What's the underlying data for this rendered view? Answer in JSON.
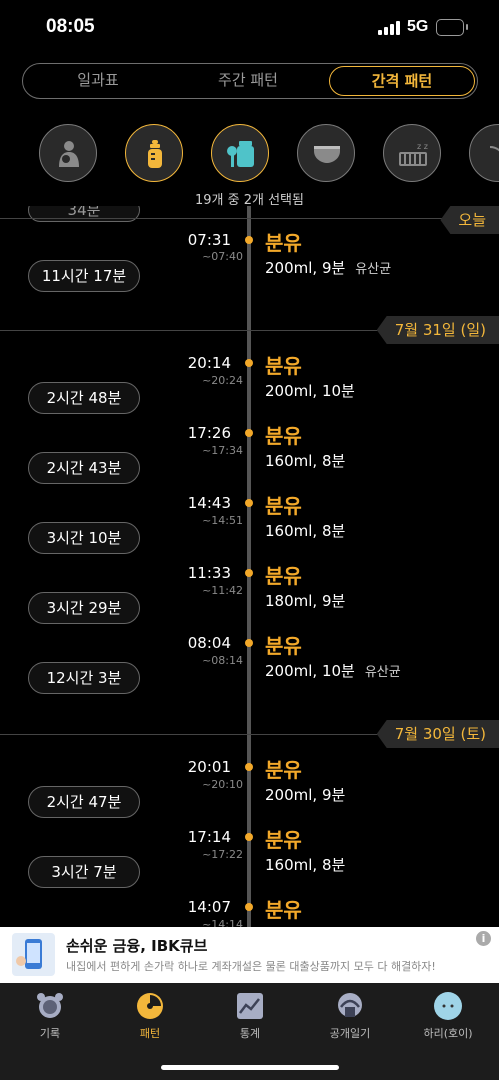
{
  "status": {
    "time": "08:05",
    "network": "5G"
  },
  "tabs": [
    {
      "label": "일과표",
      "active": false
    },
    {
      "label": "주간 패턴",
      "active": false
    },
    {
      "label": "간격 패턴",
      "active": true
    }
  ],
  "categories": [
    {
      "icon": "breastfeeding-icon",
      "selected": false
    },
    {
      "icon": "bottle-icon",
      "selected": true
    },
    {
      "icon": "pumped-milk-icon",
      "selected": true
    },
    {
      "icon": "diaper-icon",
      "selected": false
    },
    {
      "icon": "sleep-icon",
      "selected": false
    },
    {
      "icon": "more-icon",
      "selected": false
    }
  ],
  "selected_count": "19개 중 2개 선택됨",
  "timeline": {
    "partial_top_interval": "34분",
    "dates": {
      "today": "오늘",
      "d1": "7월 31일 (일)",
      "d2": "7월 30일 (토)"
    },
    "entries": [
      {
        "time": "07:31",
        "end": "~07:40",
        "type": "분유",
        "detail": "200ml, 9분",
        "note": "유산균"
      },
      {
        "time": "20:14",
        "end": "~20:24",
        "type": "분유",
        "detail": "200ml, 10분",
        "note": ""
      },
      {
        "time": "17:26",
        "end": "~17:34",
        "type": "분유",
        "detail": "160ml, 8분",
        "note": ""
      },
      {
        "time": "14:43",
        "end": "~14:51",
        "type": "분유",
        "detail": "160ml, 8분",
        "note": ""
      },
      {
        "time": "11:33",
        "end": "~11:42",
        "type": "분유",
        "detail": "180ml, 9분",
        "note": ""
      },
      {
        "time": "08:04",
        "end": "~08:14",
        "type": "분유",
        "detail": "200ml, 10분",
        "note": "유산균"
      },
      {
        "time": "20:01",
        "end": "~20:10",
        "type": "분유",
        "detail": "200ml, 9분",
        "note": ""
      },
      {
        "time": "17:14",
        "end": "~17:22",
        "type": "분유",
        "detail": "160ml, 8분",
        "note": ""
      },
      {
        "time": "14:07",
        "end": "~14:14",
        "type": "분유",
        "detail": "",
        "note": ""
      }
    ],
    "intervals": [
      "11시간 17분",
      "2시간 48분",
      "2시간 43분",
      "3시간 10분",
      "3시간 29분",
      "12시간 3분",
      "2시간 47분",
      "3시간 7분"
    ]
  },
  "ad": {
    "title": "손쉬운 금융, IBK큐브",
    "desc": "내집에서 편하게 손가락 하나로 계좌개설은 물론 대출상품까지 모두 다 해결하자!",
    "info": "i"
  },
  "nav": [
    {
      "label": "기록",
      "icon": "alarm-clock-icon",
      "active": false
    },
    {
      "label": "패턴",
      "icon": "pattern-chart-icon",
      "active": true
    },
    {
      "label": "통계",
      "icon": "statistics-icon",
      "active": false
    },
    {
      "label": "공개일기",
      "icon": "public-diary-icon",
      "active": false
    },
    {
      "label": "하리(호이)",
      "icon": "baby-avatar-icon",
      "active": false
    }
  ],
  "colors": {
    "accent": "#f3b73b",
    "background": "#000000"
  }
}
